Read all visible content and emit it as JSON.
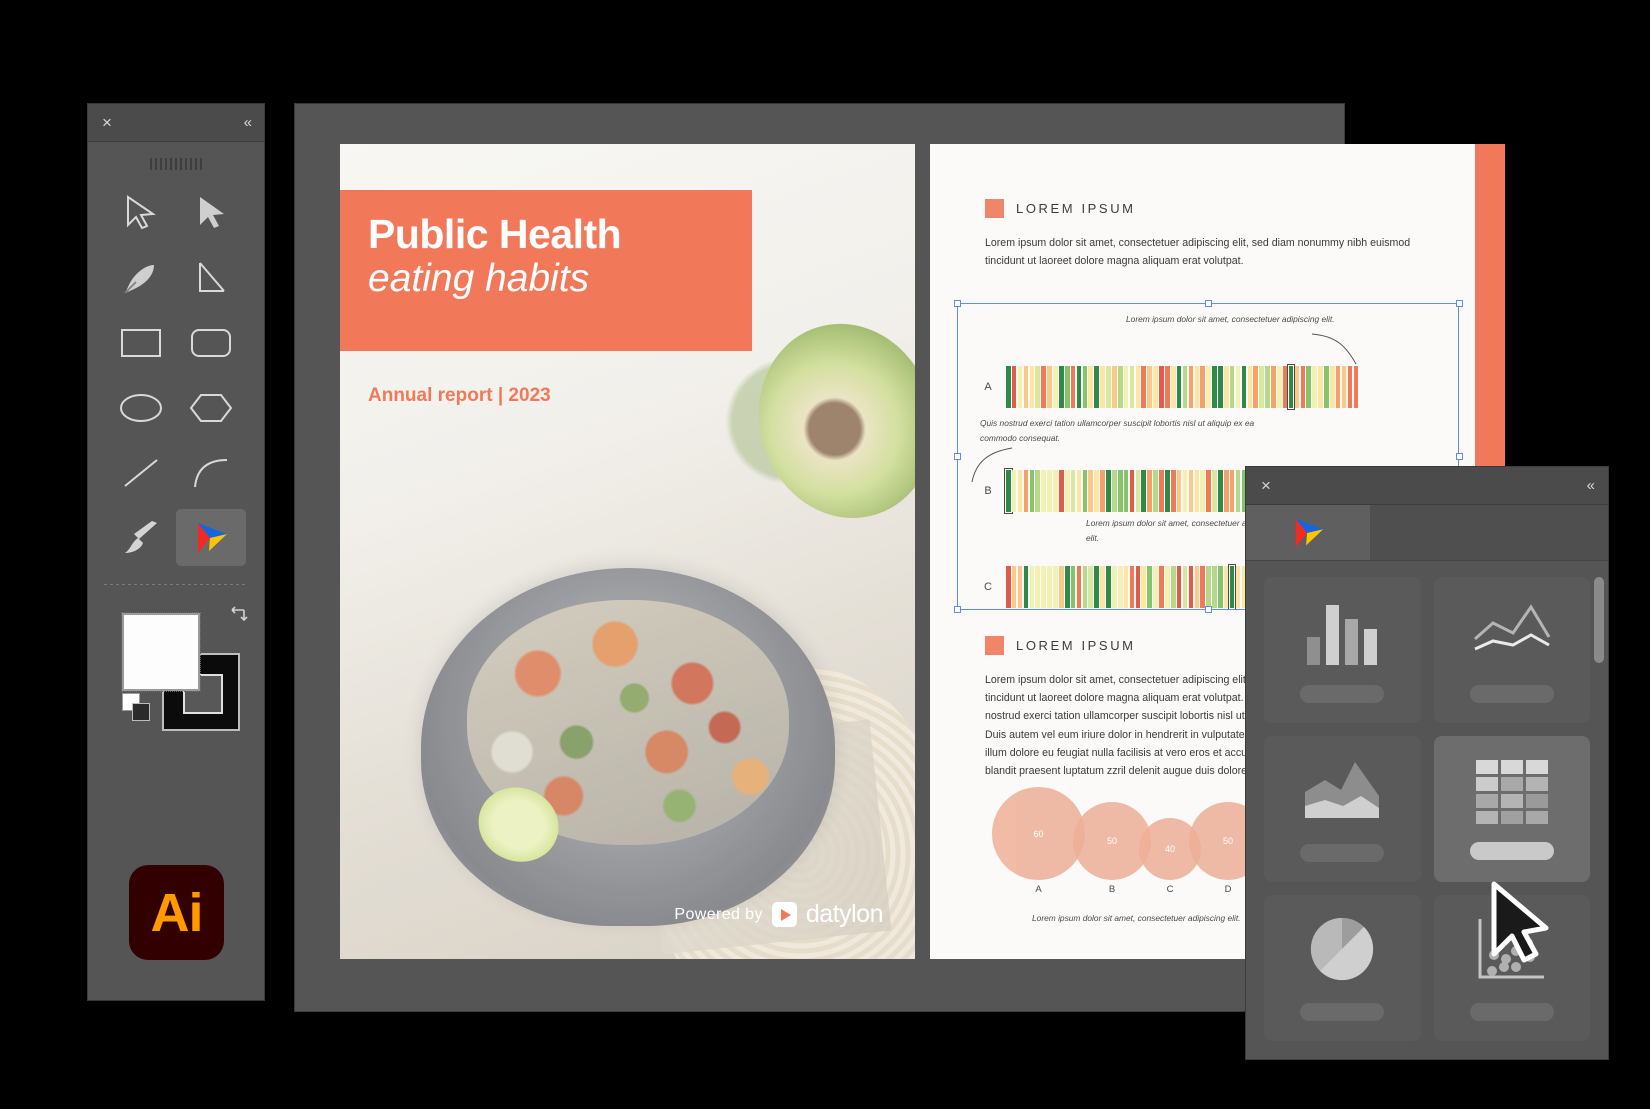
{
  "app": {
    "name": "Adobe Illustrator",
    "badge_label": "Ai"
  },
  "toolbar": {
    "close_icon": "×",
    "collapse_icon": "«",
    "tools": [
      {
        "name": "selection-tool",
        "icon": "arrow-outline-icon"
      },
      {
        "name": "direct-selection-tool",
        "icon": "arrow-filled-icon"
      },
      {
        "name": "pen-tool",
        "icon": "pen-nib-icon"
      },
      {
        "name": "curvature-tool",
        "icon": "angle-line-icon"
      },
      {
        "name": "rectangle-tool",
        "icon": "rectangle-icon"
      },
      {
        "name": "rounded-rectangle-tool",
        "icon": "rounded-rectangle-icon"
      },
      {
        "name": "ellipse-tool",
        "icon": "ellipse-icon"
      },
      {
        "name": "polygon-tool",
        "icon": "hexagon-icon"
      },
      {
        "name": "line-tool",
        "icon": "diagonal-line-icon"
      },
      {
        "name": "arc-tool",
        "icon": "arc-icon"
      },
      {
        "name": "paintbrush-tool",
        "icon": "paintbrush-icon"
      },
      {
        "name": "datylon-chart-tool",
        "icon": "datylon-logo-icon",
        "selected": true
      }
    ],
    "fill_color": "#FDFDFD",
    "stroke_color": "#0B0B0B",
    "swap_icon": "swap-fill-stroke-icon",
    "default_swatches_icon": "default-fill-stroke-icon"
  },
  "canvas": {
    "cover": {
      "title_main": "Public Health",
      "title_sub": "eating habits",
      "annual": "Annual report | 2023",
      "accent_color": "#F1795A",
      "powered_by": "Powered by",
      "brand": "datylon"
    },
    "report": {
      "accent_color": "#F1795A",
      "section1": {
        "heading": "LOREM IPSUM",
        "paragraph": "Lorem ipsum dolor sit amet, consectetuer adipiscing elit, sed diam nonummy nibh euismod tincidunt ut laoreet dolore magna aliquam erat volutpat."
      },
      "section2": {
        "heading": "LOREM IPSUM",
        "paragraph": "Lorem ipsum dolor sit amet, consectetuer adipiscing elit, sed diam nonummy nibh euismod tincidunt ut laoreet dolore magna aliquam erat volutpat. Ut wisi enim ad minim veniam, quis nostrud exerci tation ullamcorper suscipit lobortis nisl ut aliquip ex ea commodo consequat. Duis autem vel eum iriure dolor in hendrerit in vulputate velit esse molestie consequat, vel illum dolore eu feugiat nulla facilisis at vero eros et accumsan et iusto odio dignissim qui blandit praesent luptatum zzril delenit augue duis dolore te feugait nulla facilisi."
      },
      "annotations": {
        "a": "Lorem ipsum dolor sit amet, consectetuer adipiscing elit.",
        "b": "Quis nostrud exerci tation ullamcorper suscipit lobortis nisl ut aliquip ex ea commodo consequat.",
        "c": "Lorem ipsum dolor sit amet, consectetuer adipiscing elit."
      },
      "bubble_caption": "Lorem ipsum dolor sit amet, consectetuer adipiscing elit."
    }
  },
  "chart_data": [
    {
      "type": "heatmap",
      "title": "LOREM IPSUM",
      "categories": [
        "A",
        "B",
        "C"
      ],
      "row_lengths": [
        60,
        60,
        44
      ],
      "highlight_index": {
        "A": 48,
        "B": 0,
        "C": 38
      },
      "colormap": [
        "#e15b4c",
        "#ee7a57",
        "#f4a26a",
        "#f9c98a",
        "#fbe6a6",
        "#f3f0b4",
        "#d9e8a0",
        "#b4d98a",
        "#86c46b",
        "#2f8a4a"
      ],
      "xlabel": "",
      "ylabel": "",
      "grid": false,
      "legend": "none"
    },
    {
      "type": "bubble",
      "categories": [
        "A",
        "B",
        "C",
        "D"
      ],
      "values": [
        60,
        50,
        40,
        50
      ],
      "color": "#EEAF97",
      "title": "",
      "caption": "Lorem ipsum dolor sit amet, consectetuer adipiscing elit.",
      "xlabel": "",
      "ylabel": "",
      "grid": false,
      "legend": "none"
    }
  ],
  "chart_panel": {
    "close_icon": "×",
    "collapse_icon": "«",
    "tab_icon": "datylon-logo-icon",
    "cards": [
      {
        "name": "bar-chart",
        "icon": "bar-chart-icon",
        "active": false
      },
      {
        "name": "line-chart",
        "icon": "line-chart-icon",
        "active": false
      },
      {
        "name": "area-chart",
        "icon": "area-chart-icon",
        "active": false
      },
      {
        "name": "table-chart",
        "icon": "table-grid-icon",
        "active": true
      },
      {
        "name": "pie-chart",
        "icon": "pie-chart-icon",
        "active": false
      },
      {
        "name": "scatter-chart",
        "icon": "scatter-plot-icon",
        "active": false
      }
    ]
  },
  "cursor": {
    "icon": "mouse-pointer-icon"
  }
}
